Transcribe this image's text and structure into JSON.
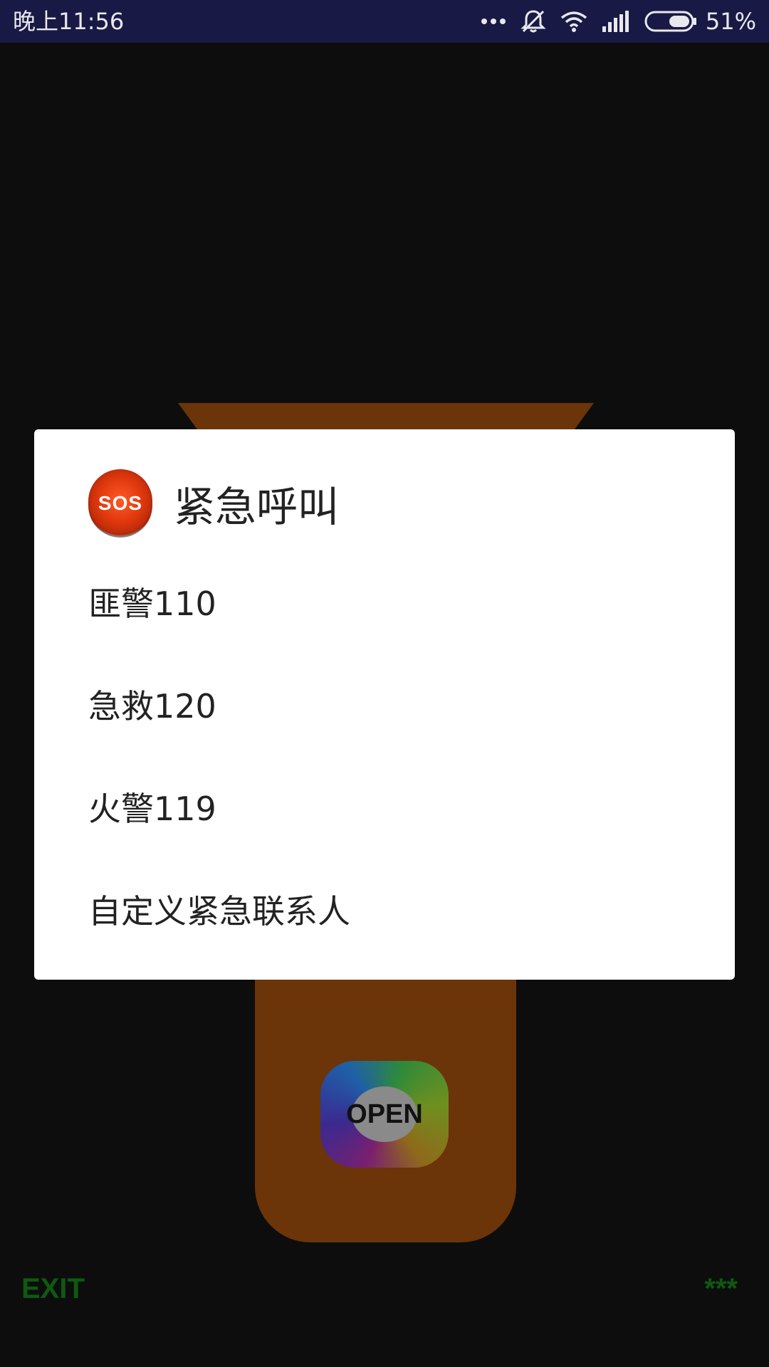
{
  "status_bar": {
    "time": "晚上11:56",
    "battery_percent": "51%",
    "icons": [
      "more-dots-icon",
      "mute-bell-icon",
      "wifi-icon",
      "signal-icon",
      "battery-icon"
    ]
  },
  "background_app": {
    "open_label": "OPEN",
    "exit_label": "EXIT",
    "stars_label": "***"
  },
  "dialog": {
    "icon_label": "SOS",
    "title": "紧急呼叫",
    "items": [
      {
        "label": "匪警110"
      },
      {
        "label": "急救120"
      },
      {
        "label": "火警119"
      },
      {
        "label": "自定义紧急联系人"
      }
    ]
  },
  "colors": {
    "status_bar_bg": "#181a45",
    "flashlight_body": "#6b3409",
    "exit_text": "#0d5a10",
    "dialog_bg": "#ffffff"
  }
}
